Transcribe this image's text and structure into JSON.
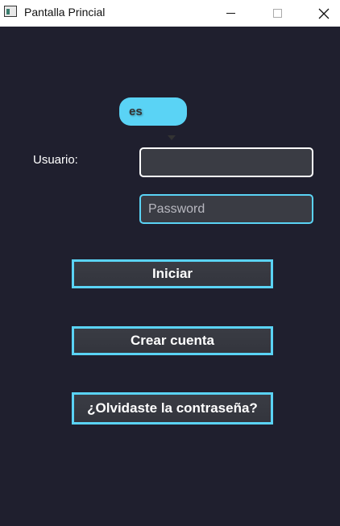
{
  "window": {
    "title": "Pantalla Princial",
    "close_symbol": "✕"
  },
  "form": {
    "language": {
      "value": "es",
      "icon": "chevron-down-icon"
    },
    "username_label": "Usuario:",
    "username_value": "",
    "password_placeholder": "Password",
    "login_button": "Iniciar",
    "create_button": "Crear cuenta",
    "forgot_button": "¿Olvidaste la contraseña?"
  },
  "colors": {
    "background": "#1f1f2e",
    "accent": "#5ad3f5",
    "field": "#3a3c44",
    "text": "#ffffff"
  }
}
